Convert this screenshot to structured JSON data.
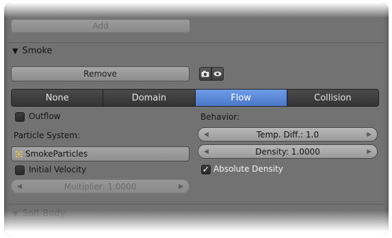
{
  "add_button": "Add",
  "smoke_section": {
    "title": "Smoke",
    "remove_button": "Remove",
    "icons": [
      "camera-icon",
      "eye-icon"
    ],
    "type_tabs": [
      "None",
      "Domain",
      "Flow",
      "Collision"
    ],
    "active_tab": "Flow",
    "outflow": {
      "label": "Outflow",
      "checked": false
    },
    "particle_system_label": "Particle System:",
    "particle_system_value": "SmokeParticles",
    "initial_velocity": {
      "label": "Initial Velocity",
      "checked": false
    },
    "multiplier": "Multiplier: 1.0000",
    "behavior_label": "Behavior:",
    "temp_diff": "Temp. Diff.: 1.0",
    "density": "Density: 1.0000",
    "absolute_density": {
      "label": "Absolute Density",
      "checked": true
    }
  },
  "soft_body_section": {
    "title": "Soft Body"
  },
  "colors": {
    "accent": "#5a88d8",
    "panel": "#727272"
  }
}
